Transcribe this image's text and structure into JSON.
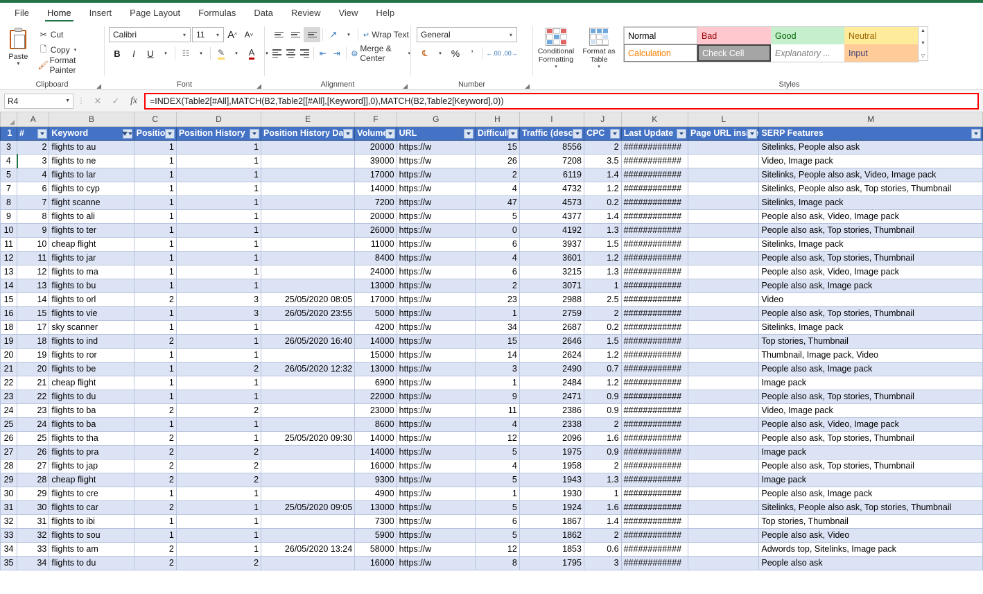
{
  "app": {
    "ribbon_tabs": [
      "File",
      "Home",
      "Insert",
      "Page Layout",
      "Formulas",
      "Data",
      "Review",
      "View",
      "Help"
    ],
    "active_tab": "Home"
  },
  "ribbon": {
    "clipboard": {
      "label": "Clipboard",
      "paste": "Paste",
      "items": [
        "Cut",
        "Copy",
        "Format Painter"
      ]
    },
    "font": {
      "label": "Font",
      "family": "Calibri",
      "size": "11",
      "grow": "A",
      "shrink": "A",
      "bold": "B",
      "italic": "I",
      "underline": "U"
    },
    "alignment": {
      "label": "Alignment",
      "wrap_text": "Wrap Text",
      "merge_center": "Merge & Center"
    },
    "number": {
      "label": "Number",
      "format": "General",
      "percent": "%",
      "comma": "‰"
    },
    "styles": {
      "label": "Styles",
      "conditional_formatting": "Conditional Formatting",
      "format_as_table": "Format as Table",
      "gallery": [
        {
          "name": "Normal",
          "bg": "#ffffff",
          "fg": "#000000",
          "border": "#bfbfbf"
        },
        {
          "name": "Bad",
          "bg": "#ffc7ce",
          "fg": "#9c0006",
          "border": "#ffc7ce"
        },
        {
          "name": "Good",
          "bg": "#c6efce",
          "fg": "#006100",
          "border": "#c6efce"
        },
        {
          "name": "Neutral",
          "bg": "#ffeb9c",
          "fg": "#9c6500",
          "border": "#ffeb9c"
        },
        {
          "name": "Calculation",
          "bg": "#ffffff",
          "fg": "#fa7d00",
          "border": "#7f7f7f"
        },
        {
          "name": "Check Cell",
          "bg": "#a5a5a5",
          "fg": "#ffffff",
          "border": "#3f3f3f"
        },
        {
          "name": "Explanatory ...",
          "bg": "#ffffff",
          "fg": "#7f7f7f",
          "border": "#ffffff"
        },
        {
          "name": "Input",
          "bg": "#ffcc99",
          "fg": "#3f3f76",
          "border": "#ffcc99"
        }
      ]
    }
  },
  "formula_bar": {
    "name_box": "R4",
    "formula": "=INDEX(Table2[#All],MATCH(B2,Table2[[#All],[Keyword]],0),MATCH(B2,Table2[Keyword],0))",
    "cancel_icon": "✕",
    "enter_icon": "✓",
    "function_icon": "fx",
    "highlight_color": "#ff0000"
  },
  "grid": {
    "column_letters": [
      "A",
      "B",
      "C",
      "D",
      "E",
      "F",
      "G",
      "H",
      "I",
      "J",
      "K",
      "L",
      "M"
    ],
    "header_row_number": "1",
    "headers": [
      {
        "label": "#",
        "filtered": false
      },
      {
        "label": "Keyword",
        "filtered": true
      },
      {
        "label": "Position",
        "filtered": false
      },
      {
        "label": "Position History",
        "filtered": false
      },
      {
        "label": "Position History Date",
        "filtered": false
      },
      {
        "label": "Volume",
        "filtered": false
      },
      {
        "label": "URL",
        "filtered": false
      },
      {
        "label": "Difficulty",
        "filtered": false
      },
      {
        "label": "Traffic (desc)",
        "filtered": false
      },
      {
        "label": "CPC",
        "filtered": false
      },
      {
        "label": "Last Update",
        "filtered": false
      },
      {
        "label": "Page URL inside",
        "filtered": false
      },
      {
        "label": "SERP Features",
        "filtered": false
      }
    ],
    "selected_row_header": "4",
    "rows": [
      {
        "rn": "3",
        "n": "2",
        "kw": "flights to au",
        "pos": "1",
        "ph": "1",
        "phd": "",
        "vol": "20000",
        "url": "https://w",
        "dif": "15",
        "traf": "8556",
        "cpc": "2",
        "lu": "############",
        "purl": "",
        "serp": "Sitelinks, People also ask"
      },
      {
        "rn": "4",
        "n": "3",
        "kw": "flights to ne",
        "pos": "1",
        "ph": "1",
        "phd": "",
        "vol": "39000",
        "url": "https://w",
        "dif": "26",
        "traf": "7208",
        "cpc": "3.5",
        "lu": "############",
        "purl": "",
        "serp": "Video, Image pack"
      },
      {
        "rn": "5",
        "n": "4",
        "kw": "flights to lar",
        "pos": "1",
        "ph": "1",
        "phd": "",
        "vol": "17000",
        "url": "https://w",
        "dif": "2",
        "traf": "6119",
        "cpc": "1.4",
        "lu": "############",
        "purl": "",
        "serp": "Sitelinks, People also ask, Video, Image pack"
      },
      {
        "rn": "7",
        "n": "6",
        "kw": "flights to cyp",
        "pos": "1",
        "ph": "1",
        "phd": "",
        "vol": "14000",
        "url": "https://w",
        "dif": "4",
        "traf": "4732",
        "cpc": "1.2",
        "lu": "############",
        "purl": "",
        "serp": "Sitelinks, People also ask, Top stories, Thumbnail"
      },
      {
        "rn": "8",
        "n": "7",
        "kw": "flight scanne",
        "pos": "1",
        "ph": "1",
        "phd": "",
        "vol": "7200",
        "url": "https://w",
        "dif": "47",
        "traf": "4573",
        "cpc": "0.2",
        "lu": "############",
        "purl": "",
        "serp": "Sitelinks, Image pack"
      },
      {
        "rn": "9",
        "n": "8",
        "kw": "flights to ali",
        "pos": "1",
        "ph": "1",
        "phd": "",
        "vol": "20000",
        "url": "https://w",
        "dif": "5",
        "traf": "4377",
        "cpc": "1.4",
        "lu": "############",
        "purl": "",
        "serp": "People also ask, Video, Image pack"
      },
      {
        "rn": "10",
        "n": "9",
        "kw": "flights to ter",
        "pos": "1",
        "ph": "1",
        "phd": "",
        "vol": "26000",
        "url": "https://w",
        "dif": "0",
        "traf": "4192",
        "cpc": "1.3",
        "lu": "############",
        "purl": "",
        "serp": "People also ask, Top stories, Thumbnail"
      },
      {
        "rn": "11",
        "n": "10",
        "kw": "cheap flight",
        "pos": "1",
        "ph": "1",
        "phd": "",
        "vol": "11000",
        "url": "https://w",
        "dif": "6",
        "traf": "3937",
        "cpc": "1.5",
        "lu": "############",
        "purl": "",
        "serp": "Sitelinks, Image pack"
      },
      {
        "rn": "12",
        "n": "11",
        "kw": "flights to jar",
        "pos": "1",
        "ph": "1",
        "phd": "",
        "vol": "8400",
        "url": "https://w",
        "dif": "4",
        "traf": "3601",
        "cpc": "1.2",
        "lu": "############",
        "purl": "",
        "serp": "People also ask, Top stories, Thumbnail"
      },
      {
        "rn": "13",
        "n": "12",
        "kw": "flights to ma",
        "pos": "1",
        "ph": "1",
        "phd": "",
        "vol": "24000",
        "url": "https://w",
        "dif": "6",
        "traf": "3215",
        "cpc": "1.3",
        "lu": "############",
        "purl": "",
        "serp": "People also ask, Video, Image pack"
      },
      {
        "rn": "14",
        "n": "13",
        "kw": "flights to bu",
        "pos": "1",
        "ph": "1",
        "phd": "",
        "vol": "13000",
        "url": "https://w",
        "dif": "2",
        "traf": "3071",
        "cpc": "1",
        "lu": "############",
        "purl": "",
        "serp": "People also ask, Image pack"
      },
      {
        "rn": "15",
        "n": "14",
        "kw": "flights to orl",
        "pos": "2",
        "ph": "3",
        "phd": "25/05/2020 08:05",
        "vol": "17000",
        "url": "https://w",
        "dif": "23",
        "traf": "2988",
        "cpc": "2.5",
        "lu": "############",
        "purl": "",
        "serp": "Video"
      },
      {
        "rn": "16",
        "n": "15",
        "kw": "flights to vie",
        "pos": "1",
        "ph": "3",
        "phd": "26/05/2020 23:55",
        "vol": "5000",
        "url": "https://w",
        "dif": "1",
        "traf": "2759",
        "cpc": "2",
        "lu": "############",
        "purl": "",
        "serp": "People also ask, Top stories, Thumbnail"
      },
      {
        "rn": "18",
        "n": "17",
        "kw": "sky scanner",
        "pos": "1",
        "ph": "1",
        "phd": "",
        "vol": "4200",
        "url": "https://w",
        "dif": "34",
        "traf": "2687",
        "cpc": "0.2",
        "lu": "############",
        "purl": "",
        "serp": "Sitelinks, Image pack"
      },
      {
        "rn": "19",
        "n": "18",
        "kw": "flights to ind",
        "pos": "2",
        "ph": "1",
        "phd": "26/05/2020 16:40",
        "vol": "14000",
        "url": "https://w",
        "dif": "15",
        "traf": "2646",
        "cpc": "1.5",
        "lu": "############",
        "purl": "",
        "serp": "Top stories, Thumbnail"
      },
      {
        "rn": "20",
        "n": "19",
        "kw": "flights to ror",
        "pos": "1",
        "ph": "1",
        "phd": "",
        "vol": "15000",
        "url": "https://w",
        "dif": "14",
        "traf": "2624",
        "cpc": "1.2",
        "lu": "############",
        "purl": "",
        "serp": "Thumbnail, Image pack, Video"
      },
      {
        "rn": "21",
        "n": "20",
        "kw": "flights to be",
        "pos": "1",
        "ph": "2",
        "phd": "26/05/2020 12:32",
        "vol": "13000",
        "url": "https://w",
        "dif": "3",
        "traf": "2490",
        "cpc": "0.7",
        "lu": "############",
        "purl": "",
        "serp": "People also ask, Image pack"
      },
      {
        "rn": "22",
        "n": "21",
        "kw": "cheap flight",
        "pos": "1",
        "ph": "1",
        "phd": "",
        "vol": "6900",
        "url": "https://w",
        "dif": "1",
        "traf": "2484",
        "cpc": "1.2",
        "lu": "############",
        "purl": "",
        "serp": "Image pack"
      },
      {
        "rn": "23",
        "n": "22",
        "kw": "flights to du",
        "pos": "1",
        "ph": "1",
        "phd": "",
        "vol": "22000",
        "url": "https://w",
        "dif": "9",
        "traf": "2471",
        "cpc": "0.9",
        "lu": "############",
        "purl": "",
        "serp": "People also ask, Top stories, Thumbnail"
      },
      {
        "rn": "24",
        "n": "23",
        "kw": "flights to ba",
        "pos": "2",
        "ph": "2",
        "phd": "",
        "vol": "23000",
        "url": "https://w",
        "dif": "11",
        "traf": "2386",
        "cpc": "0.9",
        "lu": "############",
        "purl": "",
        "serp": "Video, Image pack"
      },
      {
        "rn": "25",
        "n": "24",
        "kw": "flights to ba",
        "pos": "1",
        "ph": "1",
        "phd": "",
        "vol": "8600",
        "url": "https://w",
        "dif": "4",
        "traf": "2338",
        "cpc": "2",
        "lu": "############",
        "purl": "",
        "serp": "People also ask, Video, Image pack"
      },
      {
        "rn": "26",
        "n": "25",
        "kw": "flights to tha",
        "pos": "2",
        "ph": "1",
        "phd": "25/05/2020 09:30",
        "vol": "14000",
        "url": "https://w",
        "dif": "12",
        "traf": "2096",
        "cpc": "1.6",
        "lu": "############",
        "purl": "",
        "serp": "People also ask, Top stories, Thumbnail"
      },
      {
        "rn": "27",
        "n": "26",
        "kw": "flights to pra",
        "pos": "2",
        "ph": "2",
        "phd": "",
        "vol": "14000",
        "url": "https://w",
        "dif": "5",
        "traf": "1975",
        "cpc": "0.9",
        "lu": "############",
        "purl": "",
        "serp": "Image pack"
      },
      {
        "rn": "28",
        "n": "27",
        "kw": "flights to jap",
        "pos": "2",
        "ph": "2",
        "phd": "",
        "vol": "16000",
        "url": "https://w",
        "dif": "4",
        "traf": "1958",
        "cpc": "2",
        "lu": "############",
        "purl": "",
        "serp": "People also ask, Top stories, Thumbnail"
      },
      {
        "rn": "29",
        "n": "28",
        "kw": "cheap flight",
        "pos": "2",
        "ph": "2",
        "phd": "",
        "vol": "9300",
        "url": "https://w",
        "dif": "5",
        "traf": "1943",
        "cpc": "1.3",
        "lu": "############",
        "purl": "",
        "serp": "Image pack"
      },
      {
        "rn": "30",
        "n": "29",
        "kw": "flights to cre",
        "pos": "1",
        "ph": "1",
        "phd": "",
        "vol": "4900",
        "url": "https://w",
        "dif": "1",
        "traf": "1930",
        "cpc": "1",
        "lu": "############",
        "purl": "",
        "serp": "People also ask, Image pack"
      },
      {
        "rn": "31",
        "n": "30",
        "kw": "flights to car",
        "pos": "2",
        "ph": "1",
        "phd": "25/05/2020 09:05",
        "vol": "13000",
        "url": "https://w",
        "dif": "5",
        "traf": "1924",
        "cpc": "1.6",
        "lu": "############",
        "purl": "",
        "serp": "Sitelinks, People also ask, Top stories, Thumbnail"
      },
      {
        "rn": "32",
        "n": "31",
        "kw": "flights to ibi",
        "pos": "1",
        "ph": "1",
        "phd": "",
        "vol": "7300",
        "url": "https://w",
        "dif": "6",
        "traf": "1867",
        "cpc": "1.4",
        "lu": "############",
        "purl": "",
        "serp": "Top stories, Thumbnail"
      },
      {
        "rn": "33",
        "n": "32",
        "kw": "flights to sou",
        "pos": "1",
        "ph": "1",
        "phd": "",
        "vol": "5900",
        "url": "https://w",
        "dif": "5",
        "traf": "1862",
        "cpc": "2",
        "lu": "############",
        "purl": "",
        "serp": "People also ask, Video"
      },
      {
        "rn": "34",
        "n": "33",
        "kw": "flights to am",
        "pos": "2",
        "ph": "1",
        "phd": "26/05/2020 13:24",
        "vol": "58000",
        "url": "https://w",
        "dif": "12",
        "traf": "1853",
        "cpc": "0.6",
        "lu": "############",
        "purl": "",
        "serp": "Adwords top, Sitelinks, Image pack"
      },
      {
        "rn": "35",
        "n": "34",
        "kw": "flights to du",
        "pos": "2",
        "ph": "2",
        "phd": "",
        "vol": "16000",
        "url": "https://w",
        "dif": "8",
        "traf": "1795",
        "cpc": "3",
        "lu": "############",
        "purl": "",
        "serp": "People also ask"
      }
    ]
  }
}
